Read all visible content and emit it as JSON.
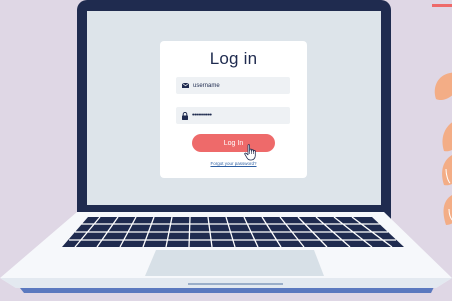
{
  "login": {
    "title": "Log in",
    "username_value": "username",
    "password_mask": "••••••••••",
    "login_button": "Log In",
    "forgot_link": "Forgot your password?"
  },
  "colors": {
    "background": "#dfd7e5",
    "laptop_frame": "#1f2b4f",
    "screen": "#dde4ea",
    "button": "#ee6a6a",
    "link": "#2d5fa3",
    "leaf_peach": "#f3ad86"
  },
  "icons": [
    "envelope-icon",
    "lock-icon",
    "hand-pointer-icon"
  ]
}
